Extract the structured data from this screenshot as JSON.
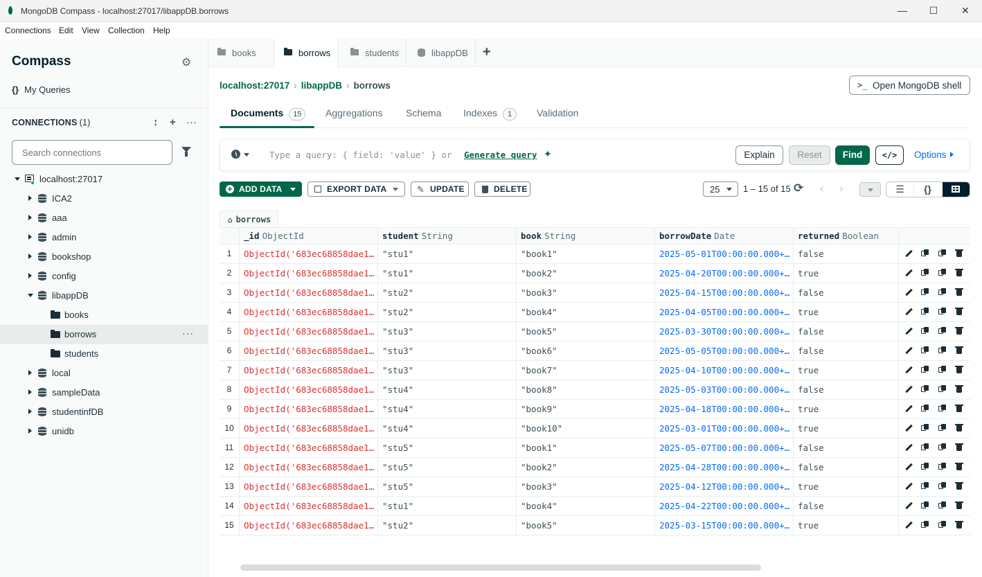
{
  "window": {
    "title": "MongoDB Compass - localhost:27017/libappDB.borrows"
  },
  "menu": [
    "Connections",
    "Edit",
    "View",
    "Collection",
    "Help"
  ],
  "sidebar": {
    "title": "Compass",
    "my_queries": "My Queries",
    "connections_label": "CONNECTIONS",
    "connections_count": "(1)",
    "search_placeholder": "Search connections",
    "host": "localhost:27017",
    "databases": [
      "ICA2",
      "aaa",
      "admin",
      "bookshop",
      "config",
      "libappDB",
      "local",
      "sampleData",
      "studentinfDB",
      "unidb"
    ],
    "expanded_db": "libappDB",
    "collections": [
      "books",
      "borrows",
      "students"
    ],
    "active_collection": "borrows"
  },
  "tabs": [
    {
      "label": "books",
      "icon": "folder-icon",
      "active": false
    },
    {
      "label": "borrows",
      "icon": "folder-icon",
      "active": true
    },
    {
      "label": "students",
      "icon": "database-icon",
      "active": false
    },
    {
      "label": "libappDB",
      "icon": "database-icon",
      "active": false
    }
  ],
  "breadcrumb": {
    "host": "localhost:27017",
    "db": "libappDB",
    "collection": "borrows"
  },
  "shell_button": "Open MongoDB shell",
  "subtabs": {
    "documents": "Documents",
    "documents_count": "15",
    "aggregations": "Aggregations",
    "schema": "Schema",
    "indexes": "Indexes",
    "indexes_count": "1",
    "validation": "Validation"
  },
  "query": {
    "placeholder": "Type a query: { field: 'value' } or",
    "generate": "Generate query",
    "explain": "Explain",
    "reset": "Reset",
    "find": "Find",
    "code": "</>",
    "options": "Options"
  },
  "toolbar": {
    "add_data": "ADD DATA",
    "export_data": "EXPORT DATA",
    "update": "UPDATE",
    "delete": "DELETE",
    "page_size": "25",
    "range": "1 – 15 of 15"
  },
  "grid": {
    "collection": "borrows",
    "columns": [
      {
        "name": "_id",
        "type": "ObjectId"
      },
      {
        "name": "student",
        "type": "String"
      },
      {
        "name": "book",
        "type": "String"
      },
      {
        "name": "borrowDate",
        "type": "Date"
      },
      {
        "name": "returned",
        "type": "Boolean"
      }
    ],
    "rows": [
      {
        "idx": "1",
        "id": "ObjectId('683ec68858dae1…",
        "student": "\"stu1\"",
        "book": "\"book1\"",
        "date": "2025-05-01T00:00:00.000+…",
        "returned": "false"
      },
      {
        "idx": "2",
        "id": "ObjectId('683ec68858dae1…",
        "student": "\"stu1\"",
        "book": "\"book2\"",
        "date": "2025-04-20T00:00:00.000+…",
        "returned": "true"
      },
      {
        "idx": "3",
        "id": "ObjectId('683ec68858dae1…",
        "student": "\"stu2\"",
        "book": "\"book3\"",
        "date": "2025-04-15T00:00:00.000+…",
        "returned": "false"
      },
      {
        "idx": "4",
        "id": "ObjectId('683ec68858dae1…",
        "student": "\"stu2\"",
        "book": "\"book4\"",
        "date": "2025-04-05T00:00:00.000+…",
        "returned": "true"
      },
      {
        "idx": "5",
        "id": "ObjectId('683ec68858dae1…",
        "student": "\"stu3\"",
        "book": "\"book5\"",
        "date": "2025-03-30T00:00:00.000+…",
        "returned": "false"
      },
      {
        "idx": "6",
        "id": "ObjectId('683ec68858dae1…",
        "student": "\"stu3\"",
        "book": "\"book6\"",
        "date": "2025-05-05T00:00:00.000+…",
        "returned": "false"
      },
      {
        "idx": "7",
        "id": "ObjectId('683ec68858dae1…",
        "student": "\"stu3\"",
        "book": "\"book7\"",
        "date": "2025-04-10T00:00:00.000+…",
        "returned": "true"
      },
      {
        "idx": "8",
        "id": "ObjectId('683ec68858dae1…",
        "student": "\"stu4\"",
        "book": "\"book8\"",
        "date": "2025-05-03T00:00:00.000+…",
        "returned": "false"
      },
      {
        "idx": "9",
        "id": "ObjectId('683ec68858dae1…",
        "student": "\"stu4\"",
        "book": "\"book9\"",
        "date": "2025-04-18T00:00:00.000+…",
        "returned": "true"
      },
      {
        "idx": "10",
        "id": "ObjectId('683ec68858dae1…",
        "student": "\"stu4\"",
        "book": "\"book10\"",
        "date": "2025-03-01T00:00:00.000+…",
        "returned": "true"
      },
      {
        "idx": "11",
        "id": "ObjectId('683ec68858dae1…",
        "student": "\"stu5\"",
        "book": "\"book1\"",
        "date": "2025-05-07T00:00:00.000+…",
        "returned": "false"
      },
      {
        "idx": "12",
        "id": "ObjectId('683ec68858dae1…",
        "student": "\"stu5\"",
        "book": "\"book2\"",
        "date": "2025-04-28T00:00:00.000+…",
        "returned": "false"
      },
      {
        "idx": "13",
        "id": "ObjectId('683ec68858dae1…",
        "student": "\"stu5\"",
        "book": "\"book3\"",
        "date": "2025-04-12T00:00:00.000+…",
        "returned": "true"
      },
      {
        "idx": "14",
        "id": "ObjectId('683ec68858dae1…",
        "student": "\"stu1\"",
        "book": "\"book4\"",
        "date": "2025-04-22T00:00:00.000+…",
        "returned": "false"
      },
      {
        "idx": "15",
        "id": "ObjectId('683ec68858dae1…",
        "student": "\"stu2\"",
        "book": "\"book5\"",
        "date": "2025-03-15T00:00:00.000+…",
        "returned": "true"
      }
    ]
  },
  "colors": {
    "brand": "#00684a",
    "link": "#016bf8",
    "objectid": "#db3030",
    "date": "#016bf8"
  }
}
